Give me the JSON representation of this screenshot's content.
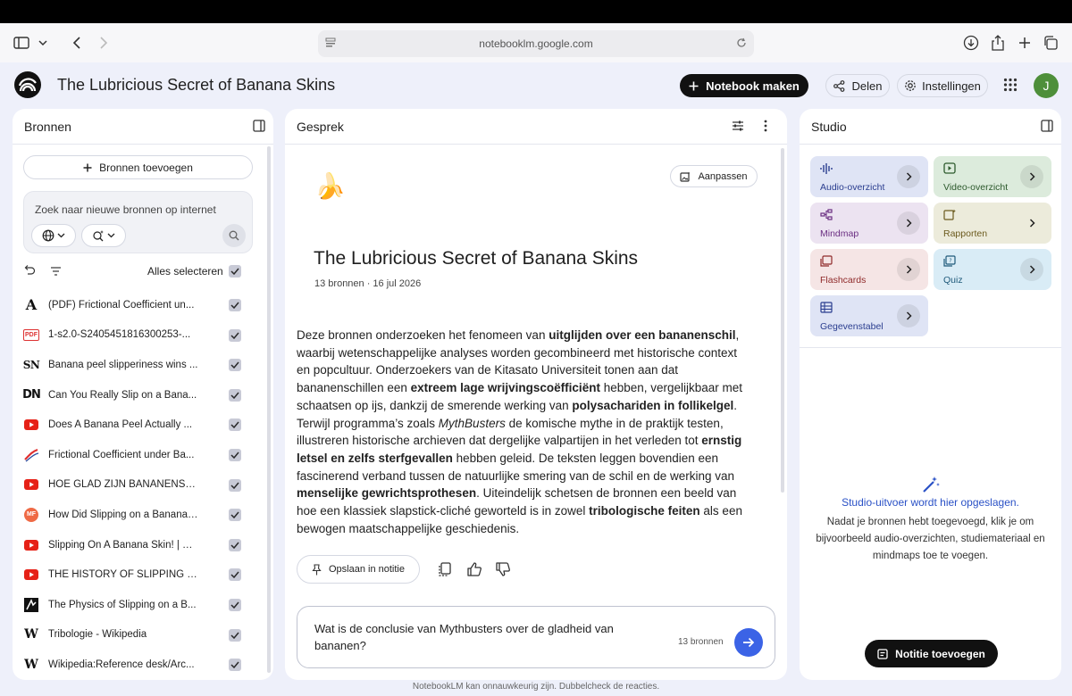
{
  "browser": {
    "url": "notebooklm.google.com"
  },
  "app": {
    "title": "The Lubricious Secret of Banana Skins",
    "new_notebook": "Notebook maken",
    "share": "Delen",
    "settings": "Instellingen",
    "avatar_initial": "J"
  },
  "sources": {
    "title": "Bronnen",
    "add_label": "Bronnen toevoegen",
    "search_placeholder": "Zoek naar nieuwe bronnen op internet",
    "select_all": "Alles selecteren",
    "items": [
      {
        "icon": "A",
        "label": "(PDF) Frictional Coefficient un..."
      },
      {
        "icon": "PDF",
        "label": "1-s2.0-S2405451816300253-..."
      },
      {
        "icon": "SN",
        "label": "Banana peel slipperiness wins ..."
      },
      {
        "icon": "DN",
        "label": "Can You Really Slip on a Bana..."
      },
      {
        "icon": "youtube",
        "label": "Does A Banana Peel Actually ..."
      },
      {
        "icon": "swoosh",
        "label": "Frictional Coefficient under Ba..."
      },
      {
        "icon": "youtube",
        "label": "HOE GLAD ZIJN BANANENSC..."
      },
      {
        "icon": "MF",
        "label": "How Did Slipping on a Banana ..."
      },
      {
        "icon": "youtube",
        "label": "Slipping On A Banana Skin! | M..."
      },
      {
        "icon": "youtube",
        "label": "THE HISTORY OF SLIPPING O..."
      },
      {
        "icon": "physics",
        "label": "The Physics of Slipping on a B..."
      },
      {
        "icon": "W",
        "label": "Tribologie - Wikipedia"
      },
      {
        "icon": "W",
        "label": "Wikipedia:Reference desk/Arc..."
      }
    ]
  },
  "chat": {
    "title": "Gesprek",
    "adjust": "Aanpassen",
    "emoji": "🍌",
    "notebook_title": "The Lubricious Secret of Banana Skins",
    "meta": "13 bronnen · 16 jul 2026",
    "summary": [
      {
        "t": "Deze bronnen onderzoeken het fenomeen van ",
        "b": false
      },
      {
        "t": "uitglijden over een bananenschil",
        "b": true
      },
      {
        "t": ", waarbij wetenschappelijke analyses worden gecombineerd met historische context en popcultuur. Onderzoekers van de Kitasato Universiteit tonen aan dat bananenschillen een ",
        "b": false
      },
      {
        "t": "extreem lage wrijvingscoëfficiënt",
        "b": true
      },
      {
        "t": " hebben, vergelijkbaar met schaatsen op ijs, dankzij de smerende werking van ",
        "b": false
      },
      {
        "t": "polysachariden in follikelgel",
        "b": true
      },
      {
        "t": ". Terwijl programma’s zoals ",
        "b": false
      },
      {
        "t": "MythBusters",
        "i": true
      },
      {
        "t": " de komische mythe in de praktijk testen, illustreren historische archieven dat dergelijke valpartijen in het verleden tot ",
        "b": false
      },
      {
        "t": "ernstig letsel en zelfs sterfgevallen",
        "b": true
      },
      {
        "t": " hebben geleid. De teksten leggen bovendien een fascinerend verband tussen de natuurlijke smering van de schil en de werking van ",
        "b": false
      },
      {
        "t": "menselijke gewrichtsprothesen",
        "b": true
      },
      {
        "t": ". Uiteindelijk schetsen de bronnen een beeld van hoe een klassiek slapstick-cliché geworteld is in zowel ",
        "b": false
      },
      {
        "t": "tribologische feiten",
        "b": true
      },
      {
        "t": " als een bewogen maatschappelijke geschiedenis.",
        "b": false
      }
    ],
    "save_note": "Opslaan in notitie",
    "composer_text": "Wat is de conclusie van Mythbusters over de gladheid van bananen?",
    "composer_count": "13 bronnen"
  },
  "studio": {
    "title": "Studio",
    "tiles": [
      {
        "label": "Audio-overzicht",
        "bg": "#dfe4f5",
        "fg": "#2a3d8f"
      },
      {
        "label": "Video-overzicht",
        "bg": "#dcebdc",
        "fg": "#2d5a2d"
      },
      {
        "label": "Mindmap",
        "bg": "#ece3f1",
        "fg": "#6b2f82"
      },
      {
        "label": "Rapporten",
        "bg": "#ecebdb",
        "fg": "#6b5a1e"
      },
      {
        "label": "Flashcards",
        "bg": "#f5e5e5",
        "fg": "#8f2a2a"
      },
      {
        "label": "Quiz",
        "bg": "#d9ecf6",
        "fg": "#1f5a7a"
      },
      {
        "label": "Gegevenstabel",
        "bg": "#dfe4f5",
        "fg": "#2a3d8f"
      }
    ],
    "empty_title": "Studio-uitvoer wordt hier opgeslagen.",
    "empty_desc": "Nadat je bronnen hebt toegevoegd, klik je om bijvoorbeeld audio-overzichten, studiemateriaal en mindmaps toe te voegen.",
    "add_note": "Notitie toevoegen"
  },
  "footer": "NotebookLM kan onnauwkeurig zijn. Dubbelcheck de reacties."
}
